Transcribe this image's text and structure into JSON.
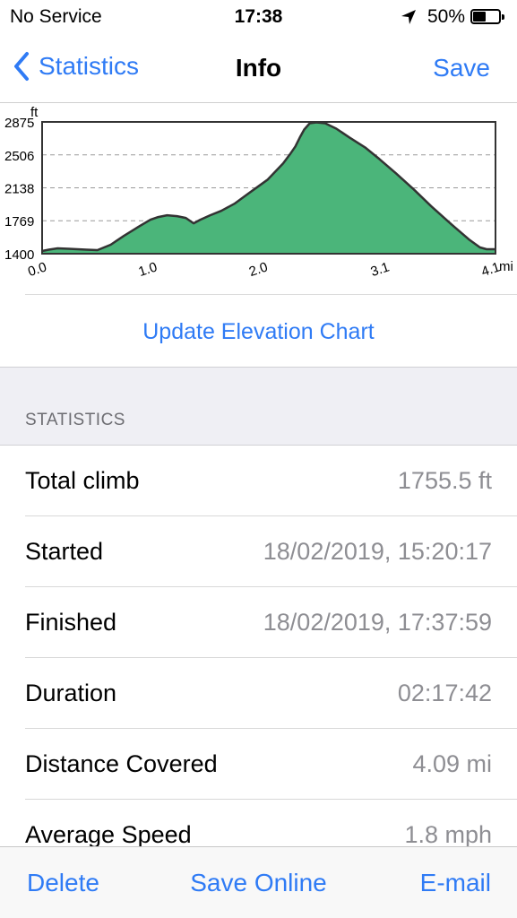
{
  "status_bar": {
    "carrier": "No Service",
    "time": "17:38",
    "battery": "50%",
    "battery_level": 0.5
  },
  "nav": {
    "back_label": "Statistics",
    "title": "Info",
    "save_label": "Save"
  },
  "chart_data": {
    "type": "area",
    "ylabel": "ft",
    "xlabel": "mi",
    "y_ticks": [
      "2875",
      "2506",
      "2138",
      "1769",
      "1400"
    ],
    "x_ticks": [
      "0.0",
      "1.0",
      "2.0",
      "3.1",
      "4.1"
    ],
    "ylim": [
      1400,
      2875
    ],
    "xlim": [
      0,
      4.1
    ],
    "grid": true,
    "fill_color": "#4bb57a",
    "line_color": "#333333",
    "x": [
      0,
      0.06,
      0.14,
      0.24,
      0.4,
      0.5,
      0.62,
      0.74,
      0.87,
      0.98,
      1.05,
      1.13,
      1.22,
      1.3,
      1.37,
      1.43,
      1.52,
      1.62,
      1.74,
      1.85,
      1.95,
      2.04,
      2.11,
      2.18,
      2.24,
      2.29,
      2.33,
      2.37,
      2.42,
      2.48,
      2.56,
      2.66,
      2.78,
      2.92,
      3.05,
      3.2,
      3.36,
      3.52,
      3.7,
      3.86,
      3.96,
      4.02,
      4.1
    ],
    "y": [
      1430,
      1445,
      1460,
      1455,
      1445,
      1440,
      1500,
      1600,
      1700,
      1780,
      1810,
      1830,
      1820,
      1800,
      1740,
      1780,
      1830,
      1880,
      1960,
      2060,
      2150,
      2230,
      2320,
      2410,
      2510,
      2600,
      2700,
      2790,
      2860,
      2870,
      2860,
      2800,
      2700,
      2590,
      2460,
      2300,
      2120,
      1930,
      1730,
      1560,
      1470,
      1450,
      1450
    ]
  },
  "update_chart_label": "Update Elevation Chart",
  "statistics": {
    "header": "STATISTICS",
    "rows": [
      {
        "label": "Total climb",
        "value": "1755.5 ft"
      },
      {
        "label": "Started",
        "value": "18/02/2019, 15:20:17"
      },
      {
        "label": "Finished",
        "value": "18/02/2019, 17:37:59"
      },
      {
        "label": "Duration",
        "value": "02:17:42"
      },
      {
        "label": "Distance Covered",
        "value": "4.09 mi"
      },
      {
        "label": "Average Speed",
        "value": "1.8 mph"
      }
    ]
  },
  "toolbar": {
    "delete_label": "Delete",
    "save_online_label": "Save Online",
    "email_label": "E-mail"
  },
  "colors": {
    "accent": "#2f7bf5",
    "secondary_text": "#8e8e93",
    "group_bg": "#efeff4"
  }
}
